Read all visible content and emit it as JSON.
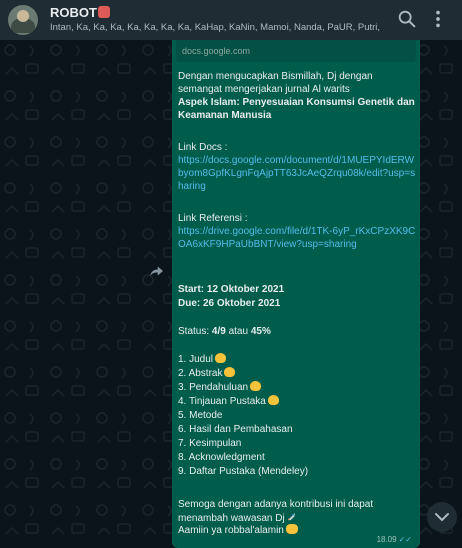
{
  "header": {
    "title": "ROBOT",
    "members": "Intan, Ka, Ka, Ka, Ka, Ka, Ka, Ka, KaHap, KaNin, Mamoi, Nanda, PaUR, Putri, ...",
    "icons": [
      "search-icon",
      "menu-icon"
    ]
  },
  "message": {
    "link_preview": "docs.google.com",
    "intro": "Dengan mengucapkan Bismillah, Dj dengan semangat mengerjakan jurnal Al warits",
    "topic": "Aspek Islam: Penyesuaian Konsumsi Genetik dan Keamanan Manusia",
    "docs_label": "Link Docs :",
    "docs_url": "https://docs.google.com/document/d/1MUEPYIdERWbyom8GpfKLgnFqAjpTT63JcAeQZrqu08k/edit?usp=sharing",
    "ref_label": "Link Referensi :",
    "ref_url": "https://drive.google.com/file/d/1TK-6yP_rKxCPzXK9COA6xKF9HPaUbBNT/view?usp=sharing",
    "start": "Start: 12 Oktober 2021",
    "due": "Due: 26 Oktober 2021",
    "status_prefix": "Status: ",
    "status_count": "4/9",
    "status_mid": " atau ",
    "status_pct": "45%",
    "progress_fraction": 0.45,
    "items": [
      {
        "text": "1. Judul",
        "done": true
      },
      {
        "text": "2. Abstrak",
        "done": true
      },
      {
        "text": "3. Pendahuluan",
        "done": true
      },
      {
        "text": "4. Tinjauan Pustaka",
        "done": true
      },
      {
        "text": "5. Metode",
        "done": false
      },
      {
        "text": "6. Hasil dan Pembahasan",
        "done": false
      },
      {
        "text": "7. Kesimpulan",
        "done": false
      },
      {
        "text": "8. Acknowledgment",
        "done": false
      },
      {
        "text": "9. Daftar Pustaka (Mendeley)",
        "done": false
      }
    ],
    "closing1": "Semoga dengan adanya kontribusi ini dapat menambah wawasan Dj",
    "closing2": "Aamiin ya robbal'alamin",
    "time": "18.09",
    "ticks": "✓✓"
  },
  "colors": {
    "header": "#202c33",
    "bubble": "#005c4b",
    "link": "#53bdeb",
    "background": "#0b141a"
  }
}
